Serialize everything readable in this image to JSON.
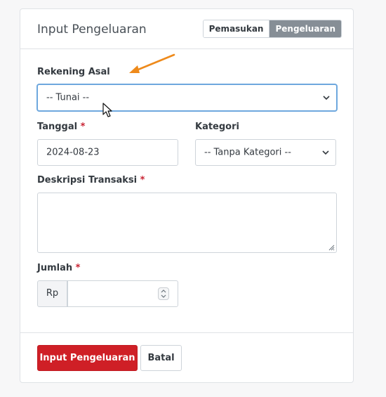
{
  "header": {
    "title": "Input Pengeluaran",
    "toggle": {
      "income": "Pemasukan",
      "expense": "Pengeluaran"
    }
  },
  "form": {
    "account": {
      "label": "Rekening Asal",
      "value": "-- Tunai --"
    },
    "date": {
      "label": "Tanggal",
      "required": "*",
      "value": "2024-08-23"
    },
    "category": {
      "label": "Kategori",
      "value": "-- Tanpa Kategori --"
    },
    "description": {
      "label": "Deskripsi Transaksi",
      "required": "*",
      "value": ""
    },
    "amount": {
      "label": "Jumlah",
      "required": "*",
      "prefix": "Rp",
      "value": ""
    }
  },
  "footer": {
    "submit": "Input Pengeluaran",
    "cancel": "Batal"
  },
  "colors": {
    "primary_danger": "#cf1f26",
    "annotation_arrow": "#ee8a1b",
    "active_toggle": "#868e96"
  }
}
